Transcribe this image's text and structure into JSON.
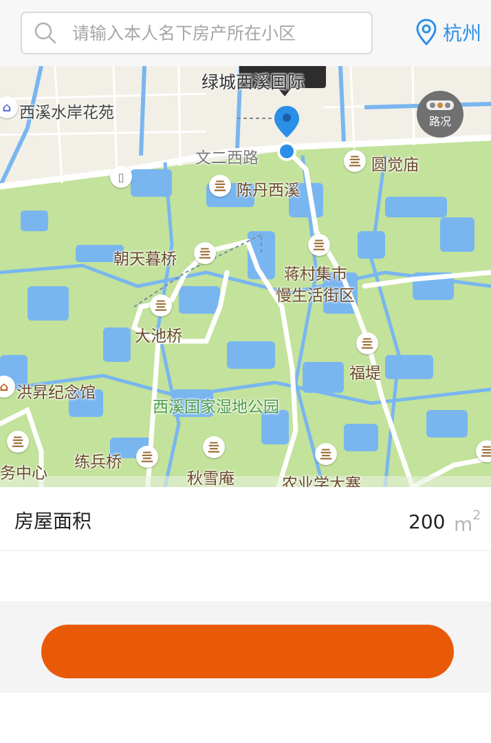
{
  "search": {
    "placeholder": "请输入本人名下房产所在小区",
    "value": ""
  },
  "location": {
    "city": "杭州",
    "icon": "location-pin-icon"
  },
  "map": {
    "selected_place": "绿城西溪国际",
    "traffic_button_label": "路况",
    "labels": {
      "residence": "西溪水岸花苑",
      "road": "文二西路",
      "yuanjuemiao": "圆觉庙",
      "chendan": "陈丹西溪",
      "chaotian": "朝天暮桥",
      "jiangcun": "蒋村集市",
      "manshenghuo": "慢生活街区",
      "dachi": "大池桥",
      "futi": "福堤",
      "hongsheng": "洪昇纪念馆",
      "park": "西溪国家湿地公园",
      "service": "务中心",
      "lianbing": "练兵桥",
      "qiuxue": "秋雪庵",
      "nongye": "农业学大寨"
    },
    "colors": {
      "land": "#c3e29b",
      "water": "#79b6f0",
      "urban": "#f2efe6",
      "road": "#ffffff"
    }
  },
  "form": {
    "area_label": "房屋面积",
    "area_value": "200",
    "area_unit": "m",
    "area_unit_power": "2"
  },
  "submit": {
    "label": "",
    "color": "#e95a08"
  }
}
